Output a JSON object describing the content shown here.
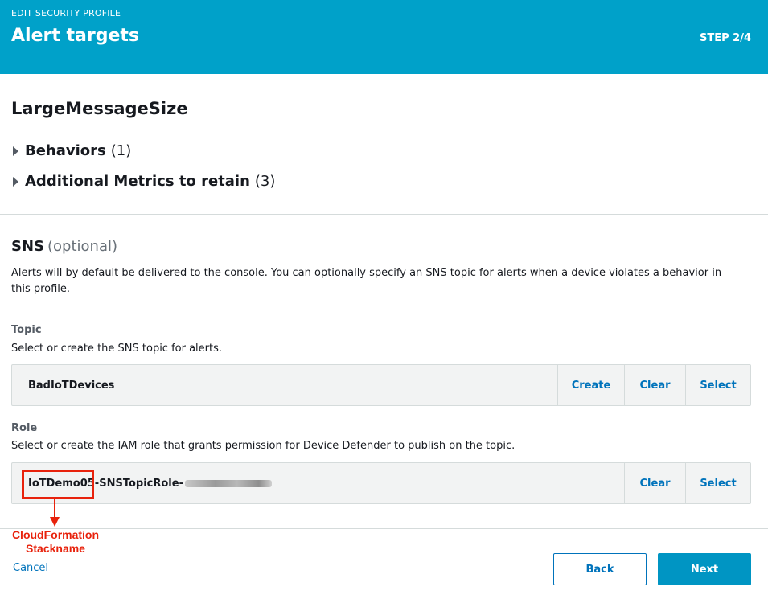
{
  "header": {
    "eyebrow": "EDIT SECURITY PROFILE",
    "title": "Alert targets",
    "step": "STEP 2/4"
  },
  "profile": {
    "name": "LargeMessageSize"
  },
  "sections": {
    "behaviors": {
      "label": "Behaviors",
      "count": "(1)"
    },
    "metrics": {
      "label": "Additional Metrics to retain",
      "count": "(3)"
    }
  },
  "sns": {
    "title": "SNS",
    "optional": "(optional)",
    "description": "Alerts will by default be delivered to the console. You can optionally specify an SNS topic for alerts when a device violates a behavior in this profile."
  },
  "topic": {
    "label": "Topic",
    "help": "Select or create the SNS topic for alerts.",
    "value": "BadIoTDevices",
    "create_label": "Create",
    "clear_label": "Clear",
    "select_label": "Select"
  },
  "role": {
    "label": "Role",
    "help": "Select or create the IAM role that grants permission for Device Defender to publish on the topic.",
    "value": "IoTDemo05-SNSTopicRole-",
    "clear_label": "Clear",
    "select_label": "Select"
  },
  "annotation": {
    "line1": "CloudFormation",
    "line2": "Stackname",
    "color": "#e8220c"
  },
  "footer": {
    "cancel_label": "Cancel",
    "back_label": "Back",
    "next_label": "Next"
  },
  "colors": {
    "header_bg": "#00a1c9",
    "link": "#0073bb",
    "primary_button": "#0095c3"
  }
}
